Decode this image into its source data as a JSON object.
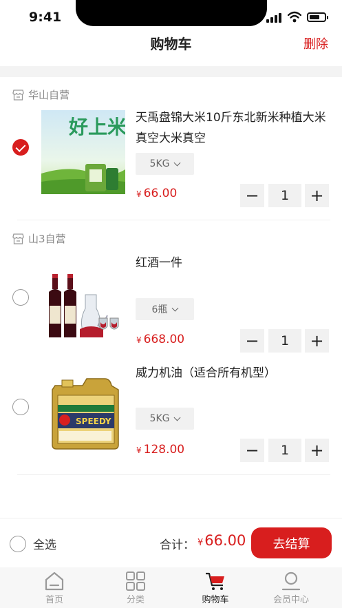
{
  "status": {
    "time": "9:41"
  },
  "nav": {
    "title": "购物车",
    "action": "删除"
  },
  "stores": [
    {
      "name": "华山自营",
      "items": [
        {
          "name": "天禹盘锦大米10斤东北新米种植大米真空大米真空",
          "spec": "5KG",
          "price": "66.00",
          "qty": "1",
          "checked": true,
          "img_text": "好上米桌"
        }
      ]
    },
    {
      "name": "山3自营",
      "items": [
        {
          "name": "红酒一件",
          "spec": "6瓶",
          "price": "668.00",
          "qty": "1",
          "checked": false
        },
        {
          "name": "威力机油（适合所有机型）",
          "spec": "5KG",
          "price": "128.00",
          "qty": "1",
          "checked": false,
          "img_text": "SPEEDY"
        }
      ]
    }
  ],
  "currency": "¥",
  "checkout": {
    "select_all": "全选",
    "total_label": "合计：",
    "total_value": "66.00",
    "button": "去结算"
  },
  "tabbar": [
    {
      "label": "首页",
      "icon": "home-icon"
    },
    {
      "label": "分类",
      "icon": "grid-icon"
    },
    {
      "label": "购物车",
      "icon": "cart-icon",
      "active": true
    },
    {
      "label": "会员中心",
      "icon": "user-icon"
    }
  ],
  "colors": {
    "accent": "#d81e1e",
    "muted": "#999999",
    "chip_bg": "#f1f1f1"
  }
}
